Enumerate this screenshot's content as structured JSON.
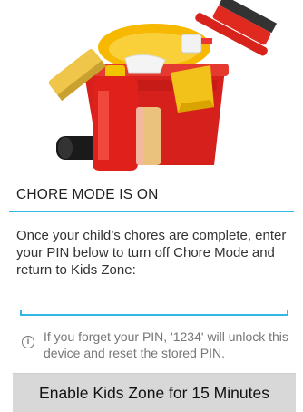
{
  "hero": {
    "image_name": "cleaning-supplies-bucket"
  },
  "section": {
    "title": "CHORE MODE IS ON"
  },
  "instructions": {
    "text": "Once your child’s chores are complete, enter your PIN below to turn off Chore Mode and return to Kids Zone:"
  },
  "pin_field": {
    "value": "",
    "placeholder": ""
  },
  "info": {
    "icon": "info-icon",
    "glyph": "i",
    "text": "If you forget your PIN, '1234' will unlock this device and reset the stored PIN."
  },
  "action_button": {
    "label": "Enable Kids Zone for 15 Minutes"
  },
  "colors": {
    "accent": "#33b5e5",
    "button_bg": "#d8d8d8",
    "secondary_text": "#777777"
  }
}
